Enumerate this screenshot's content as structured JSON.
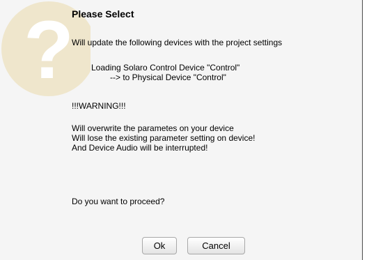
{
  "dialog": {
    "title": "Please Select",
    "intro": "Will update the following devices with the project settings",
    "loading_line": "Loading Solaro Control Device \"Control\"",
    "target_line": "--> to Physical Device \"Control\"",
    "warning_heading": "!!!WARNING!!!",
    "warning_lines": [
      "Will overwrite the parametes on your device",
      "Will lose the existing parameter setting on device!",
      "And Device Audio will be interrupted!"
    ],
    "question": "Do you want to proceed?",
    "ok_label": "Ok",
    "cancel_label": "Cancel"
  },
  "icons": {
    "watermark": "question-mark-icon"
  },
  "colors": {
    "watermark": "#efe6cc",
    "background": "#f5f5f5"
  }
}
